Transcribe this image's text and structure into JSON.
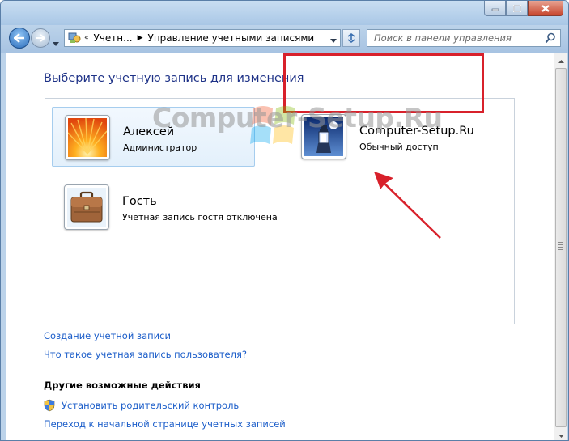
{
  "address_bar": {
    "segments": [
      "Учетн...",
      "Управление учетными записями"
    ]
  },
  "search": {
    "placeholder": "Поиск в панели управления"
  },
  "page_title": "Выберите учетную запись для изменения",
  "accounts": [
    {
      "name": "Алексей",
      "type": "Администратор",
      "picture": "orange-flower-icon"
    },
    {
      "name": "Computer-Setup.Ru",
      "type": "Обычный доступ",
      "picture": "lighthouse-icon"
    },
    {
      "name": "Гость",
      "type": "Учетная запись гостя отключена",
      "picture": "briefcase-icon"
    }
  ],
  "watermark": "Computer-Setup.Ru",
  "links": {
    "create_account": "Создание учетной записи",
    "what_is_account": "Что такое учетная запись пользователя?"
  },
  "other_actions": {
    "title": "Другие возможные действия",
    "parental_control": "Установить родительский контроль",
    "go_to_main": "Переход к начальной странице учетных записей"
  },
  "colors": {
    "title": "#1e3287",
    "link": "#1b5dc9",
    "highlight": "#d8212b"
  }
}
